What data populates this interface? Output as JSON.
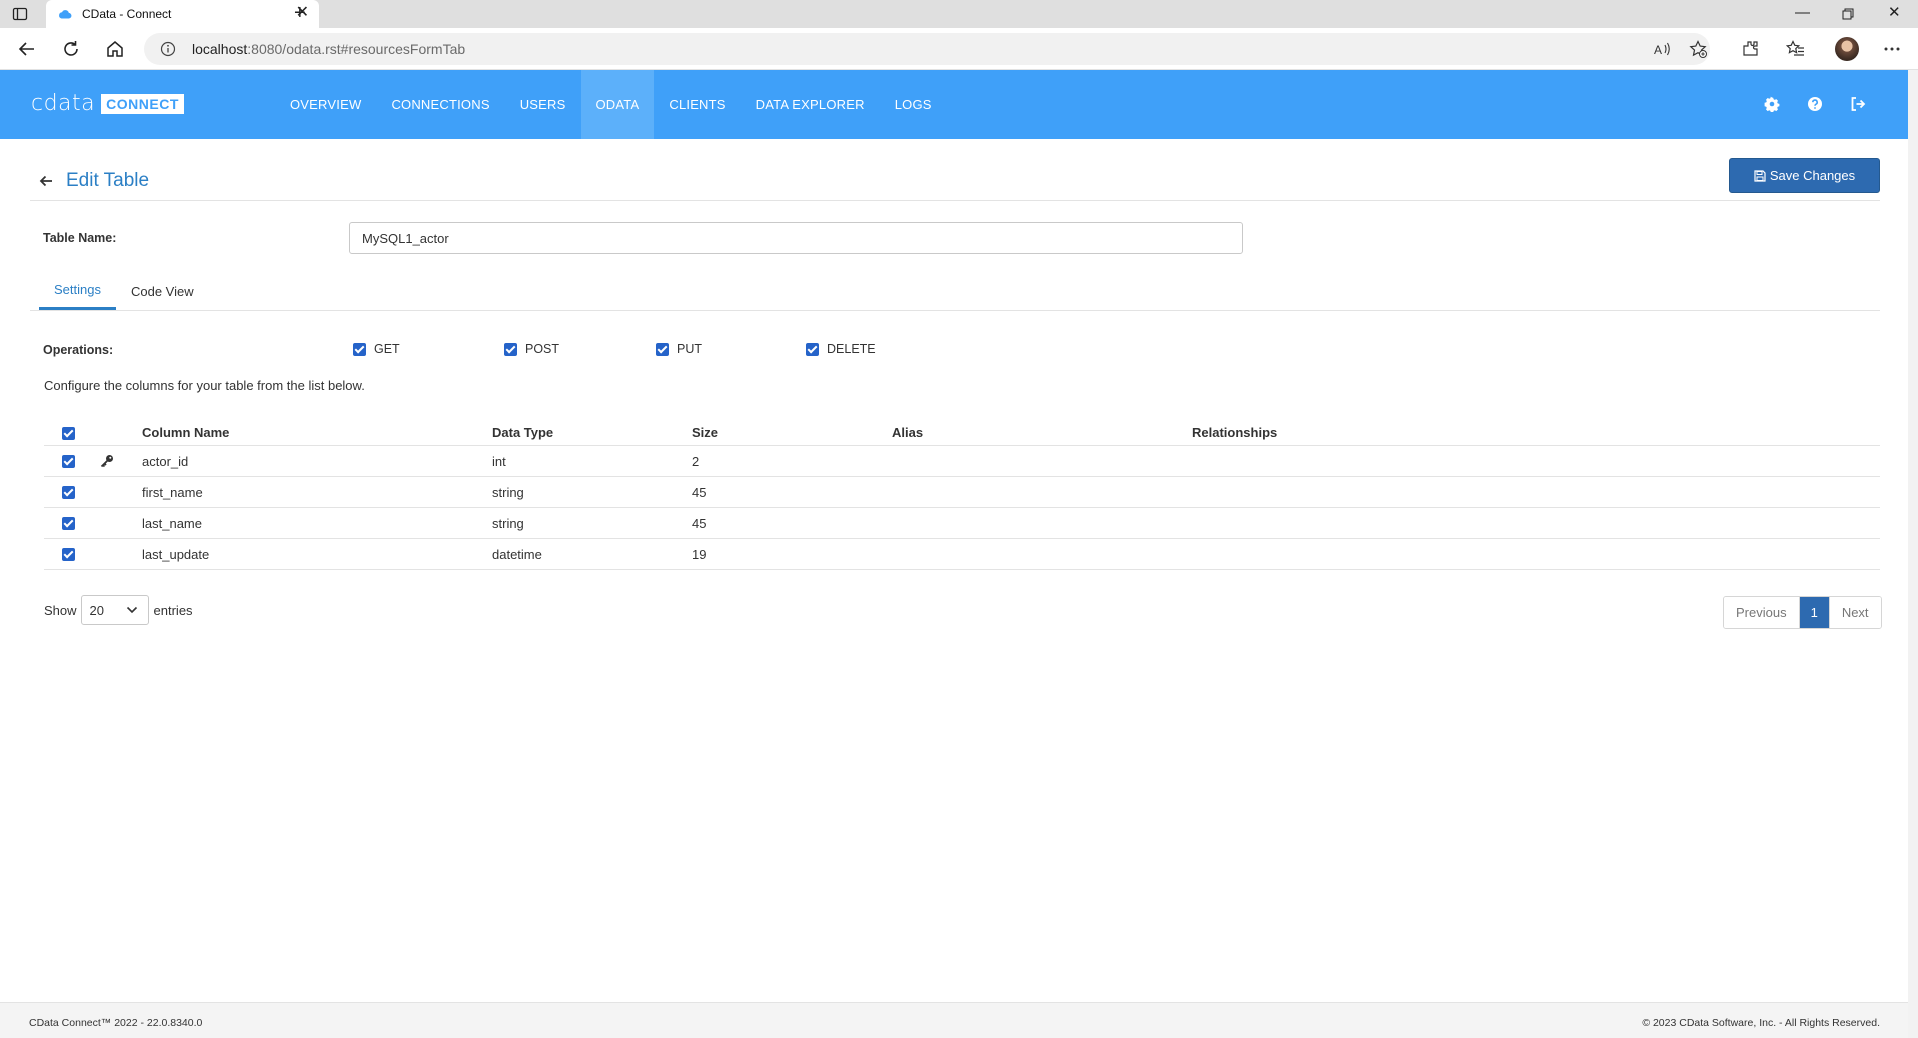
{
  "browser": {
    "tab_title": "CData - Connect",
    "url_host": "localhost",
    "url_rest": ":8080/odata.rst#resourcesFormTab"
  },
  "header": {
    "logo_text": "cdata",
    "logo_badge": "CONNECT",
    "nav": [
      {
        "label": "OVERVIEW"
      },
      {
        "label": "CONNECTIONS"
      },
      {
        "label": "USERS"
      },
      {
        "label": "ODATA"
      },
      {
        "label": "CLIENTS"
      },
      {
        "label": "DATA EXPLORER"
      },
      {
        "label": "LOGS"
      }
    ],
    "active_nav": "ODATA"
  },
  "page": {
    "title": "Edit Table",
    "save_label": "Save Changes",
    "table_name_label": "Table Name:",
    "table_name_value": "MySQL1_actor",
    "tabs": [
      {
        "label": "Settings"
      },
      {
        "label": "Code View"
      }
    ],
    "active_tab": "Settings",
    "operations_label": "Operations:",
    "operations": [
      {
        "label": "GET",
        "checked": true
      },
      {
        "label": "POST",
        "checked": true
      },
      {
        "label": "PUT",
        "checked": true
      },
      {
        "label": "DELETE",
        "checked": true
      }
    ],
    "description": "Configure the columns for your table from the list below."
  },
  "table": {
    "headers": {
      "column_name": "Column Name",
      "data_type": "Data Type",
      "size": "Size",
      "alias": "Alias",
      "relationships": "Relationships"
    },
    "rows": [
      {
        "name": "actor_id",
        "type": "int",
        "size": "2",
        "alias": "",
        "relationships": "",
        "key": true,
        "checked": true
      },
      {
        "name": "first_name",
        "type": "string",
        "size": "45",
        "alias": "",
        "relationships": "",
        "key": false,
        "checked": true
      },
      {
        "name": "last_name",
        "type": "string",
        "size": "45",
        "alias": "",
        "relationships": "",
        "key": false,
        "checked": true
      },
      {
        "name": "last_update",
        "type": "datetime",
        "size": "19",
        "alias": "",
        "relationships": "",
        "key": false,
        "checked": true
      }
    ]
  },
  "paging": {
    "show_label": "Show",
    "entries_value": "20",
    "entries_label": "entries",
    "previous": "Previous",
    "current_page": "1",
    "next": "Next"
  },
  "footer": {
    "version": "CData Connect™ 2022 - 22.0.8340.0",
    "copyright": "© 2023 CData Software, Inc. - All Rights Reserved."
  },
  "colors": {
    "header_bg": "#3fa0f9",
    "active_nav_bg": "#5cb0fa",
    "primary_button": "#2d6ab0",
    "link_blue": "#2b7fc5",
    "checkbox": "#2563c9"
  }
}
